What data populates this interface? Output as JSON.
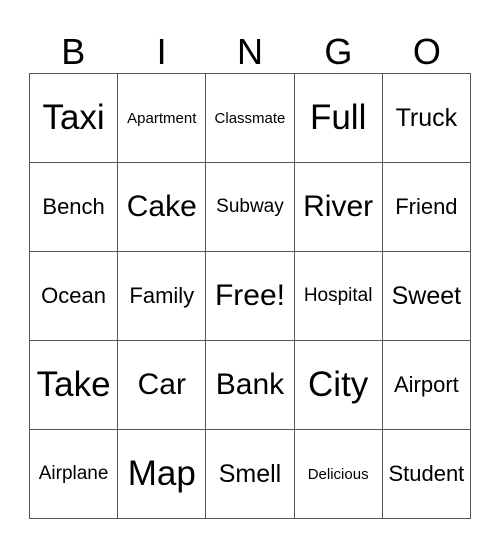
{
  "header": [
    "B",
    "I",
    "N",
    "G",
    "O"
  ],
  "rows": [
    [
      "Taxi",
      "Apartment",
      "Classmate",
      "Full",
      "Truck"
    ],
    [
      "Bench",
      "Cake",
      "Subway",
      "River",
      "Friend"
    ],
    [
      "Ocean",
      "Family",
      "Free!",
      "Hospital",
      "Sweet"
    ],
    [
      "Take",
      "Car",
      "Bank",
      "City",
      "Airport"
    ],
    [
      "Airplane",
      "Map",
      "Smell",
      "Delicious",
      "Student"
    ]
  ]
}
